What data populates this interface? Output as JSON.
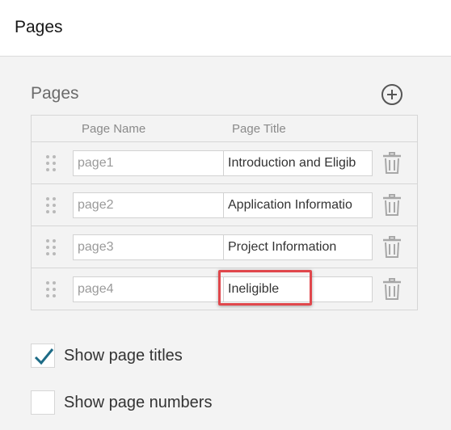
{
  "header": {
    "title": "Pages"
  },
  "pages_panel": {
    "section_title": "Pages",
    "add_icon": "plus-circle-icon",
    "columns": {
      "name": "Page Name",
      "title": "Page Title"
    },
    "rows": [
      {
        "name": "page1",
        "title": "Introduction and Eligib"
      },
      {
        "name": "page2",
        "title": "Application Informatio"
      },
      {
        "name": "page3",
        "title": "Project Information"
      },
      {
        "name": "page4",
        "title": "Ineligible"
      }
    ]
  },
  "options": {
    "show_page_titles": {
      "label": "Show page titles",
      "checked": true
    },
    "show_page_numbers": {
      "label": "Show page numbers",
      "checked": false
    }
  },
  "colors": {
    "accent": "#1d6b86",
    "highlight": "#e0474c",
    "icon_gray": "#a8a8a8"
  }
}
